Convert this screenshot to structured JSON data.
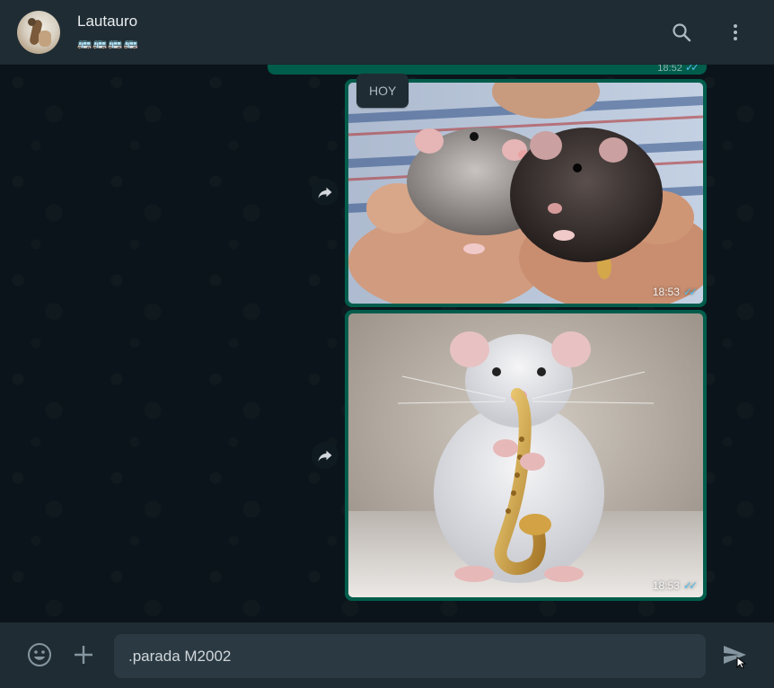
{
  "header": {
    "contact_name": "Lautauro",
    "status": "🚌🚌🚌🚌"
  },
  "chat": {
    "previous_message": {
      "time": "18:52"
    },
    "date_divider": "HOY",
    "messages": [
      {
        "type": "image",
        "subject": "two rats held in hands",
        "time": "18:53",
        "status": "read"
      },
      {
        "type": "image",
        "subject": "white rat playing saxophone",
        "time": "18:53",
        "status": "read"
      }
    ]
  },
  "composer": {
    "input_value": ".parada M2002"
  },
  "colors": {
    "header_bg": "#1f2c33",
    "chat_bg": "#0b141a",
    "outgoing_bubble": "#005c4b",
    "read_ticks": "#53bdeb",
    "input_bg": "#2a3942"
  },
  "icons": [
    "search-icon",
    "menu-icon",
    "forward-icon",
    "emoji-icon",
    "plus-icon",
    "send-icon"
  ]
}
